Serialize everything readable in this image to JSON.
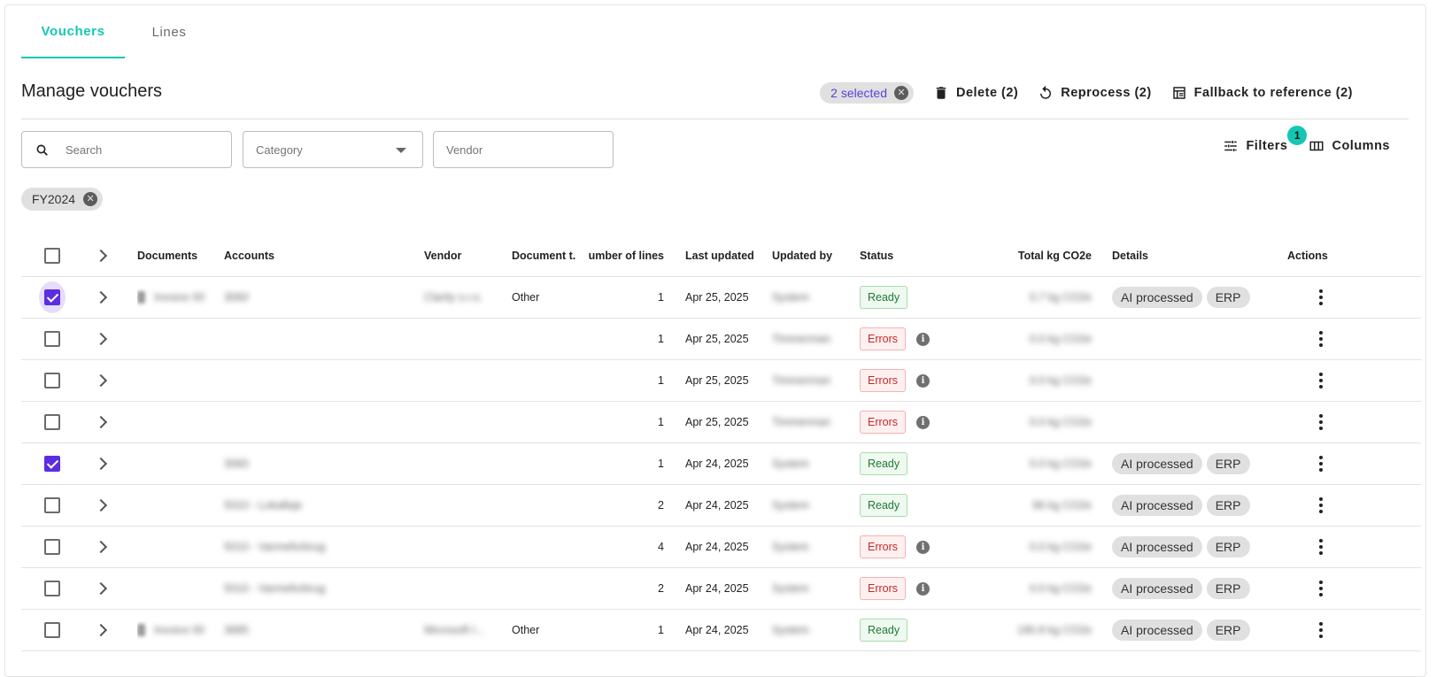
{
  "tabs": [
    {
      "label": "Vouchers",
      "active": true
    },
    {
      "label": "Lines",
      "active": false
    }
  ],
  "page_title": "Manage vouchers",
  "toolbar": {
    "selected_label": "2 selected",
    "delete_label": "Delete (2)",
    "reprocess_label": "Reprocess (2)",
    "fallback_label": "Fallback to reference (2)"
  },
  "filters": {
    "search_placeholder": "Search",
    "category_placeholder": "Category",
    "vendor_placeholder": "Vendor",
    "filters_label": "Filters",
    "filters_badge": "1",
    "columns_label": "Columns",
    "active_chip": "FY2024"
  },
  "columns": {
    "documents": "Documents",
    "accounts": "Accounts",
    "vendor": "Vendor",
    "document_type": "Document t...",
    "number_of_lines": "umber of lines",
    "last_updated": "Last updated",
    "updated_by": "Updated by",
    "status": "Status",
    "total_kg": "Total kg CO2e",
    "details": "Details",
    "actions": "Actions"
  },
  "rows": [
    {
      "checked": true,
      "halo": true,
      "doc": "Invoice 00",
      "has_doc": true,
      "account": "3060",
      "vendor": "Clarity s.r.o.",
      "doctype": "Other",
      "lines": "1",
      "updated": "Apr 25, 2025",
      "by": "System",
      "status": "Ready",
      "kg": "0.7 kg CO2e",
      "details": [
        "AI processed",
        "ERP"
      ]
    },
    {
      "checked": false,
      "halo": false,
      "doc": "",
      "has_doc": false,
      "account": "",
      "vendor": "",
      "doctype": "",
      "lines": "1",
      "updated": "Apr 25, 2025",
      "by": "Timmerman",
      "status": "Errors",
      "kg": "0.0 kg CO2e",
      "details": []
    },
    {
      "checked": false,
      "halo": false,
      "doc": "",
      "has_doc": false,
      "account": "",
      "vendor": "",
      "doctype": "",
      "lines": "1",
      "updated": "Apr 25, 2025",
      "by": "Timmerman",
      "status": "Errors",
      "kg": "0.0 kg CO2e",
      "details": []
    },
    {
      "checked": false,
      "halo": false,
      "doc": "",
      "has_doc": false,
      "account": "",
      "vendor": "",
      "doctype": "",
      "lines": "1",
      "updated": "Apr 25, 2025",
      "by": "Timmerman",
      "status": "Errors",
      "kg": "0.0 kg CO2e",
      "details": []
    },
    {
      "checked": true,
      "halo": false,
      "doc": "",
      "has_doc": false,
      "account": "3060",
      "vendor": "",
      "doctype": "",
      "lines": "1",
      "updated": "Apr 24, 2025",
      "by": "System",
      "status": "Ready",
      "kg": "0.0 kg CO2e",
      "details": [
        "AI processed",
        "ERP"
      ]
    },
    {
      "checked": false,
      "halo": false,
      "doc": "",
      "has_doc": false,
      "account": "5010 - Lokalleje",
      "vendor": "",
      "doctype": "",
      "lines": "2",
      "updated": "Apr 24, 2025",
      "by": "System",
      "status": "Ready",
      "kg": "96 kg CO2e",
      "details": [
        "AI processed",
        "ERP"
      ]
    },
    {
      "checked": false,
      "halo": false,
      "doc": "",
      "has_doc": false,
      "account": "5010 - Varmeforbrug",
      "vendor": "",
      "doctype": "",
      "lines": "4",
      "updated": "Apr 24, 2025",
      "by": "System",
      "status": "Errors",
      "kg": "0.0 kg CO2e",
      "details": [
        "AI processed",
        "ERP"
      ]
    },
    {
      "checked": false,
      "halo": false,
      "doc": "",
      "has_doc": false,
      "account": "5010 - Varmeforbrug",
      "vendor": "",
      "doctype": "",
      "lines": "2",
      "updated": "Apr 24, 2025",
      "by": "System",
      "status": "Errors",
      "kg": "0.0 kg CO2e",
      "details": [
        "AI processed",
        "ERP"
      ]
    },
    {
      "checked": false,
      "halo": false,
      "doc": "Invoice 00",
      "has_doc": true,
      "account": "3685",
      "vendor": "Microsoft I...",
      "doctype": "Other",
      "lines": "1",
      "updated": "Apr 24, 2025",
      "by": "System",
      "status": "Ready",
      "kg": "190.8 kg CO2e",
      "details": [
        "AI processed",
        "ERP"
      ]
    }
  ]
}
